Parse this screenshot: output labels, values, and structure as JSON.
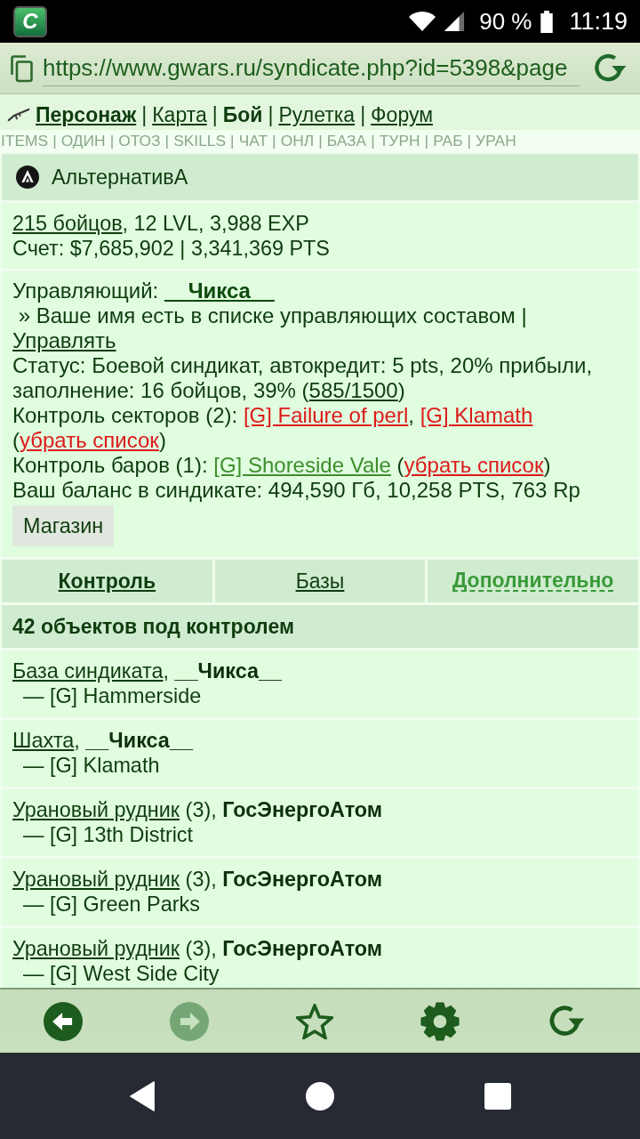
{
  "status_bar": {
    "app_badge": "C",
    "battery": "90 %",
    "time": "11:19"
  },
  "address_bar": {
    "url": "https://www.gwars.ru/syndicate.php?id=5398&page"
  },
  "nav": {
    "separator": "|",
    "items": [
      {
        "label": "Персонаж",
        "bold": true,
        "selected": false
      },
      {
        "label": "Карта",
        "bold": false,
        "selected": false
      },
      {
        "label": "Бой",
        "bold": true,
        "selected": true
      },
      {
        "label": "Рулетка",
        "bold": false,
        "selected": false
      },
      {
        "label": "Форум",
        "bold": false,
        "selected": false
      }
    ]
  },
  "quick_links": {
    "separator": "|",
    "items": [
      "ITEMS",
      "ОДИН",
      "ОТОЗ",
      "SKILLS",
      "ЧАТ",
      "ОНЛ",
      "БАЗА",
      "ТУРН",
      "РАБ",
      "УРАН"
    ]
  },
  "syndicate": {
    "name": "АльтернативА",
    "summary": [
      [
        {
          "kind": "link",
          "text": "215 бойцов"
        },
        {
          "kind": "text",
          "text": ", 12 LVL, 3,988 EXP"
        }
      ],
      [
        {
          "kind": "text",
          "text": "Счет: $7,685,902 | 3,341,369 PTS"
        }
      ]
    ],
    "management": [
      [
        {
          "kind": "text",
          "text": "Управляющий: "
        },
        {
          "kind": "player",
          "text": "__Чикса__"
        }
      ],
      [
        {
          "kind": "text",
          "text": " » Ваше имя есть в списке управляющих составом | "
        },
        {
          "kind": "link",
          "text": "Управлять"
        }
      ],
      [
        {
          "kind": "text",
          "text": "Статус: Боевой синдикат, автокредит: 5 pts, 20% прибыли, заполнение: 16 бойцов, 39% ("
        },
        {
          "kind": "link",
          "text": "585/1500"
        },
        {
          "kind": "text",
          "text": ")"
        }
      ],
      [
        {
          "kind": "text",
          "text": "Контроль секторов (2): "
        },
        {
          "kind": "sector",
          "text": "[G] Failure of perl"
        },
        {
          "kind": "text",
          "text": ", "
        },
        {
          "kind": "sector",
          "text": "[G] Klamath"
        },
        {
          "kind": "text",
          "text": " ("
        },
        {
          "kind": "remove",
          "text": "убрать список"
        },
        {
          "kind": "text",
          "text": ")"
        }
      ],
      [
        {
          "kind": "text",
          "text": "Контроль баров (1): "
        },
        {
          "kind": "bar",
          "text": "[G] Shoreside Vale"
        },
        {
          "kind": "text",
          "text": " ("
        },
        {
          "kind": "remove",
          "text": "убрать список"
        },
        {
          "kind": "text",
          "text": ")"
        }
      ],
      [
        {
          "kind": "text",
          "text": "Ваш баланс в синдикате: 494,590 Гб, 10,258 PTS, 763 Rp"
        }
      ]
    ],
    "shop_button": "Магазин"
  },
  "tabs": [
    {
      "label": "Контроль",
      "selected": true,
      "kind": "link"
    },
    {
      "label": "Базы",
      "selected": false,
      "kind": "link"
    },
    {
      "label": "Дополнительно",
      "selected": false,
      "kind": "toggle"
    }
  ],
  "objects": {
    "heading": "42 объектов под контролем",
    "items": [
      {
        "title": [
          {
            "kind": "object",
            "text": "База синдиката"
          },
          {
            "kind": "text",
            "text": ", "
          },
          {
            "kind": "owner",
            "text": "__Чикса__"
          }
        ],
        "location": "— [G] Hammerside"
      },
      {
        "title": [
          {
            "kind": "object",
            "text": "Шахта"
          },
          {
            "kind": "text",
            "text": ", "
          },
          {
            "kind": "owner",
            "text": "__Чикса__"
          }
        ],
        "location": "— [G] Klamath"
      },
      {
        "title": [
          {
            "kind": "object",
            "text": "Урановый рудник"
          },
          {
            "kind": "text",
            "text": " (3), "
          },
          {
            "kind": "owner",
            "text": "ГосЭнергоАтом"
          }
        ],
        "location": "— [G] 13th District"
      },
      {
        "title": [
          {
            "kind": "object",
            "text": "Урановый рудник"
          },
          {
            "kind": "text",
            "text": " (3), "
          },
          {
            "kind": "owner",
            "text": "ГосЭнергоАтом"
          }
        ],
        "location": "— [G] Green Parks"
      },
      {
        "title": [
          {
            "kind": "object",
            "text": "Урановый рудник"
          },
          {
            "kind": "text",
            "text": " (3), "
          },
          {
            "kind": "owner",
            "text": "ГосЭнергоАтом"
          }
        ],
        "location": "— [G] West Side City"
      }
    ]
  },
  "toolbar": [
    {
      "kind": "back",
      "disabled": false
    },
    {
      "kind": "forward",
      "disabled": true
    },
    {
      "kind": "bookmark",
      "disabled": false
    },
    {
      "kind": "settings",
      "disabled": false
    },
    {
      "kind": "reload",
      "disabled": false
    }
  ]
}
